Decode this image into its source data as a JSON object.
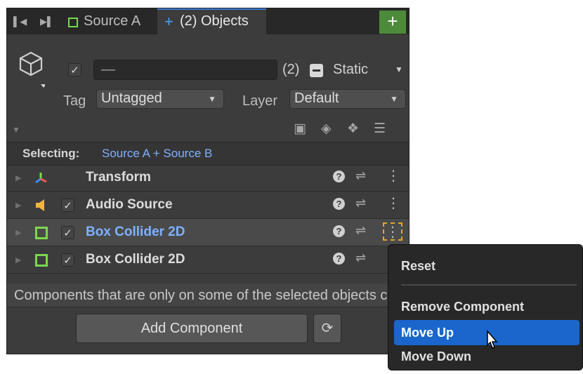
{
  "tabs": {
    "source_a": "Source A",
    "objects": "(2) Objects",
    "add_symbol": "+"
  },
  "header": {
    "name_value": "—",
    "count": "(2)",
    "static_label": "Static",
    "tag_label": "Tag",
    "tag_value": "Untagged",
    "layer_label": "Layer",
    "layer_value": "Default"
  },
  "selecting": {
    "label": "Selecting:",
    "value": "Source A + Source B"
  },
  "components": [
    {
      "name": "Transform",
      "checkbox": false
    },
    {
      "name": "Audio Source",
      "checkbox": true
    },
    {
      "name": "Box Collider 2D",
      "checkbox": true,
      "highlighted": true
    },
    {
      "name": "Box Collider 2D",
      "checkbox": true
    }
  ],
  "note": "Components that are only on some of the selected objects cannot be multi-edited.",
  "add_component": "Add Component",
  "context_menu": {
    "items": [
      "Reset",
      "Remove Component",
      "Move Up",
      "Move Down"
    ],
    "selected": "Move Up"
  },
  "colors": {
    "accent": "#1a66cc",
    "link": "#7fb1ff",
    "green": "#7bd84f",
    "focus": "#e0a92a"
  }
}
